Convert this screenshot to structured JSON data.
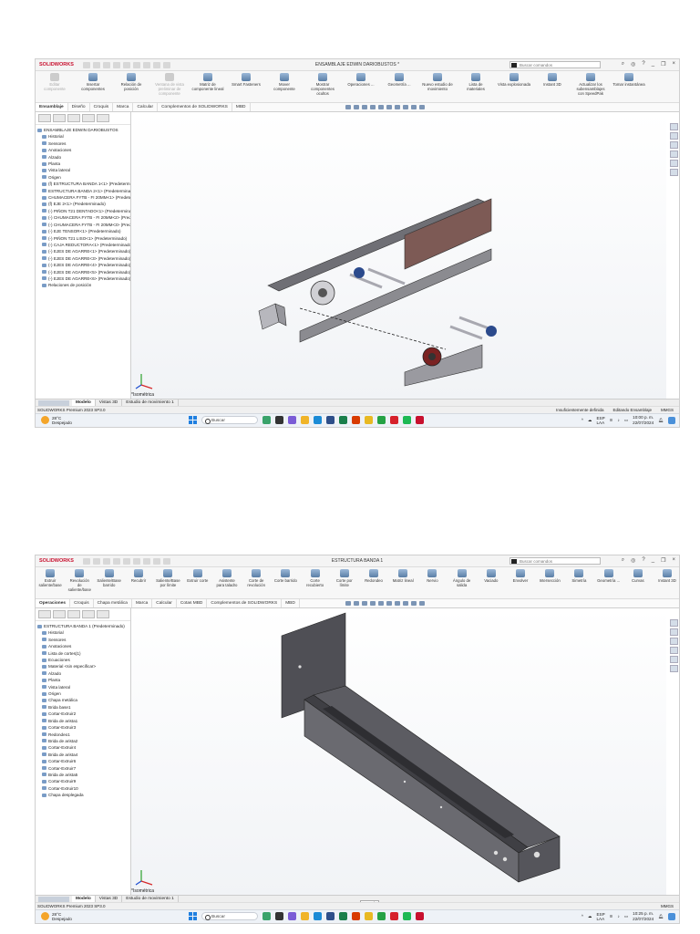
{
  "shots": [
    {
      "app": "SOLIDWORKS",
      "doc_title": "ENSAMBLAJE EDWIN DARIOBUSTOS *",
      "search_placeholder": "Buscar comandos",
      "ribbon": [
        {
          "label": "Editar componente",
          "disabled": true
        },
        {
          "label": "Insertar componentes",
          "disabled": false
        },
        {
          "label": "Relación de posición",
          "disabled": false
        },
        {
          "label": "Ventana de vista preliminar de componente",
          "disabled": true
        },
        {
          "label": "Matriz de componente lineal",
          "disabled": false
        },
        {
          "label": "Smart Fasteners",
          "disabled": false
        },
        {
          "label": "Mover componente",
          "disabled": false
        },
        {
          "label": "Mostrar componentes ocultos",
          "disabled": false
        },
        {
          "label": "Operaciones ...",
          "disabled": false
        },
        {
          "label": "Geometría ...",
          "disabled": false
        },
        {
          "label": "Nuevo estudio de movimiento",
          "disabled": false
        },
        {
          "label": "Lista de materiales",
          "disabled": false
        },
        {
          "label": "Vista explosionada",
          "disabled": false
        },
        {
          "label": "Instant 3D",
          "disabled": false
        },
        {
          "label": "Actualizar los subensamblajes con SpeedPak",
          "disabled": false
        },
        {
          "label": "Tomar instantánea",
          "disabled": false
        }
      ],
      "tabs": [
        "Ensamblaje",
        "Diseño",
        "Croquis",
        "Marca",
        "Calcular",
        "Complementos de SOLIDWORKS",
        "MBD"
      ],
      "active_tab": 0,
      "tree": [
        "ENSAMBLAJE EDWIN DARIOBUSTOS",
        "Historial",
        "Sensores",
        "Anotaciones",
        "Alzado",
        "Planta",
        "Vista lateral",
        "Origen",
        "(f) ESTRUCTURA BANDA 1<1> (Predeterminado)",
        "ESTRUCTURA BANDA 2<1> (Predeterminado)",
        "CHUMACERA FYTB - FI 20MM<1> (Predeterminado)",
        "(f) EJE 2<1> (Predeterminado)",
        "(-) PIÑON T21 DENTADO<1> (Predeterminado)",
        "(-) CHUMACERA FYTB - FI 20MM<2> (Predeterminado)",
        "(-) CHUMACERA FYTB - FI 20MM<3> (Predeterminado)",
        "(-) EJE TENSOR<1> (Predeterminado)",
        "(-) PIÑON T21 LISO<1> (Predeterminado)",
        "(-) CAJA REDUCTORA<1> (Predeterminado)",
        "(-) EJES DE AGARRE<1> (Predeterminado)",
        "(-) EJES DE AGARRE<3> (Predeterminado)",
        "(-) EJES DE AGARRE<4> (Predeterminado)",
        "(-) EJES DE AGARRE<5> (Predeterminado)",
        "(-) EJES DE AGARRE<6> (Predeterminado)",
        "Relaciones de posición"
      ],
      "view_label": "*Isométrica",
      "bottom_tabs": [
        "Modelo",
        "Vistas 3D",
        "Estudio de movimiento 1"
      ],
      "status_left": "SOLIDWORKS Premium 2023 SP3.0",
      "status_right": [
        "Insuficientemente definida",
        "Editando Ensamblaje",
        "MMGS"
      ],
      "weather_temp": "28°C",
      "weather_desc": "Despejado",
      "taskbar_search": "Buscar",
      "lang": "ESP",
      "lang2": "LAA",
      "time": "10:00 p. m.",
      "date": "22/07/2024"
    },
    {
      "app": "SOLIDWORKS",
      "doc_title": "ESTRUCTURA BANDA 1",
      "search_placeholder": "Buscar comandos",
      "ribbon": [
        {
          "label": "Extruir saliente/base",
          "disabled": false
        },
        {
          "label": "Revolución de saliente/base",
          "disabled": false
        },
        {
          "label": "Saliente/Base barrido",
          "disabled": false
        },
        {
          "label": "Recubrir",
          "disabled": false
        },
        {
          "label": "Saliente/Base por límite",
          "disabled": false
        },
        {
          "label": "Extruir corte",
          "disabled": false
        },
        {
          "label": "Asistente para taladro",
          "disabled": false
        },
        {
          "label": "Corte de revolución",
          "disabled": false
        },
        {
          "label": "Corte barrido",
          "disabled": false
        },
        {
          "label": "Corte recubierto",
          "disabled": false
        },
        {
          "label": "Corte por límite",
          "disabled": false
        },
        {
          "label": "Redondeo",
          "disabled": false
        },
        {
          "label": "Matriz lineal",
          "disabled": false
        },
        {
          "label": "Nervio",
          "disabled": false
        },
        {
          "label": "Ángulo de salida",
          "disabled": false
        },
        {
          "label": "Vaciado",
          "disabled": false
        },
        {
          "label": "Envolver",
          "disabled": false
        },
        {
          "label": "Intersección",
          "disabled": false
        },
        {
          "label": "Simetría",
          "disabled": false
        },
        {
          "label": "Geometría ...",
          "disabled": false
        },
        {
          "label": "Curvas",
          "disabled": false
        },
        {
          "label": "Instant 3D",
          "disabled": false
        }
      ],
      "tabs": [
        "Operaciones",
        "Croquis",
        "Chapa metálica",
        "Marca",
        "Calcular",
        "Cotas MBD",
        "Complementos de SOLIDWORKS",
        "MBD"
      ],
      "active_tab": 0,
      "tree": [
        "ESTRUCTURA BANDA 1 (Predeterminado)",
        "Historial",
        "Sensores",
        "Anotaciones",
        "Lista de cortes(1)",
        "Ecuaciones",
        "Material <sin especificar>",
        "Alzado",
        "Planta",
        "Vista lateral",
        "Origen",
        "Chapa metálica",
        "Brida base1",
        "Cortar-Extruir2",
        "Brida de arista1",
        "Cortar-Extruir3",
        "Redondeo1",
        "Brida de arista2",
        "Cortar-Extruir4",
        "Brida de arista4",
        "Cortar-Extruir6",
        "Cortar-Extruir7",
        "Brida de arista5",
        "Cortar-Extruir9",
        "Cortar-Extruir10",
        "Chapa desplegada"
      ],
      "view_label": "*Isométrica",
      "bottom_tabs": [
        "Modelo",
        "Vistas 3D",
        "Estudio de movimiento 1"
      ],
      "status_left": "SOLIDWORKS Premium 2023 SP3.0",
      "status_right": [
        "",
        "",
        "MMGS"
      ],
      "tooltip": "Word",
      "weather_temp": "28°C",
      "weather_desc": "Despejado",
      "taskbar_search": "Buscar",
      "lang": "ESP",
      "lang2": "LAA",
      "time": "10:25 p. m.",
      "date": "22/07/2024"
    }
  ],
  "colors": {
    "brand_red": "#c8102e",
    "tree_icon_blue": "#7a9cc6",
    "win_blue": "#1f7fe0"
  }
}
